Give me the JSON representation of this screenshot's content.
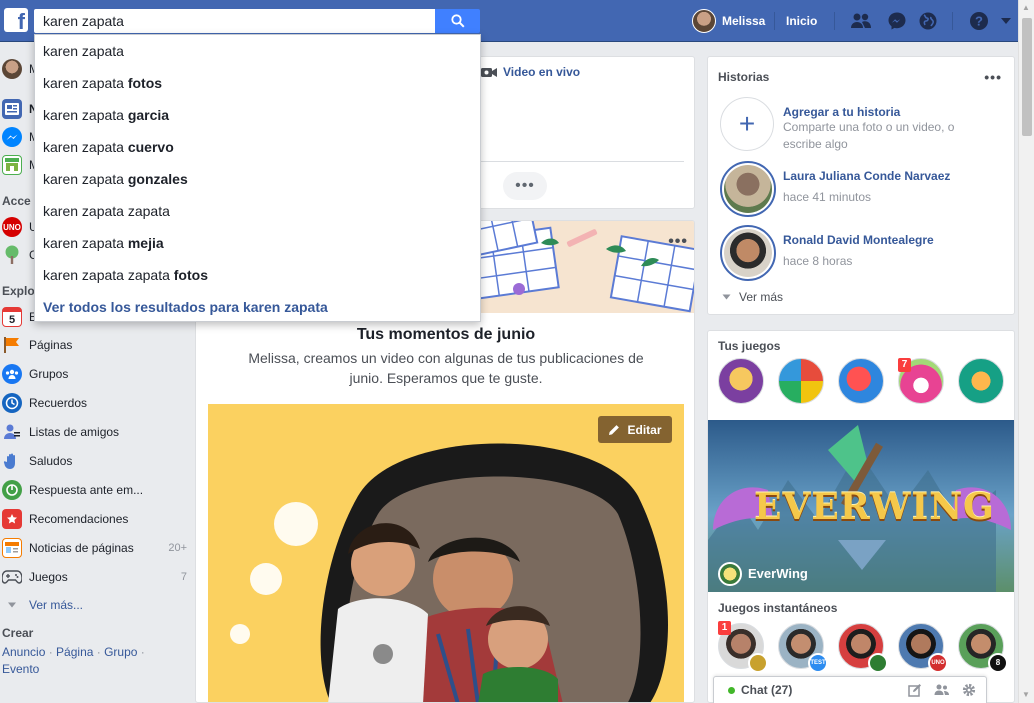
{
  "topbar": {
    "logo": "f",
    "search_value": "karen zapata",
    "user_name": "Melissa",
    "home_label": "Inicio",
    "icons": [
      "friend-requests-icon",
      "messenger-icon",
      "notifications-globe-icon",
      "help-icon",
      "account-menu-icon"
    ]
  },
  "search_suggestions": {
    "items": [
      {
        "base": "karen zapata",
        "bold": ""
      },
      {
        "base": "karen zapata ",
        "bold": "fotos"
      },
      {
        "base": "karen zapata ",
        "bold": "garcia"
      },
      {
        "base": "karen zapata ",
        "bold": "cuervo"
      },
      {
        "base": "karen zapata ",
        "bold": "gonzales"
      },
      {
        "base": "karen zapata zapata",
        "bold": ""
      },
      {
        "base": "karen zapata ",
        "bold": "mejia"
      },
      {
        "base": "karen zapata zapata ",
        "bold": "fotos"
      }
    ],
    "see_all": "Ver todos los resultados para karen zapata"
  },
  "left_nav": {
    "profile_initial": "M",
    "top_items": [
      {
        "label": "N",
        "icon": "news-feed-icon"
      },
      {
        "label": "M",
        "icon": "messenger-icon"
      },
      {
        "label": "M",
        "icon": "marketplace-icon"
      }
    ],
    "shortcuts_head": "Acce",
    "shortcuts": [
      {
        "label": "U",
        "icon": "uno-game-icon"
      },
      {
        "label": "G",
        "icon": "tree-icon"
      }
    ],
    "explore_head": "Explo",
    "explore_first": {
      "label": "E",
      "icon": "events-calendar-icon",
      "calendar_day": "5"
    },
    "explore": [
      {
        "label": "Páginas",
        "icon": "pages-flag-icon",
        "count": ""
      },
      {
        "label": "Grupos",
        "icon": "groups-icon",
        "count": ""
      },
      {
        "label": "Recuerdos",
        "icon": "memories-clock-icon",
        "count": ""
      },
      {
        "label": "Listas de amigos",
        "icon": "friend-lists-icon",
        "count": ""
      },
      {
        "label": "Saludos",
        "icon": "pokes-hand-icon",
        "count": ""
      },
      {
        "label": "Respuesta ante em...",
        "icon": "crisis-response-icon",
        "count": ""
      },
      {
        "label": "Recomendaciones",
        "icon": "recommendations-icon",
        "count": ""
      },
      {
        "label": "Noticias de páginas",
        "icon": "pages-feed-icon",
        "count": "20+"
      },
      {
        "label": "Juegos",
        "icon": "games-controller-icon",
        "count": "7"
      }
    ],
    "see_more": "Ver más...",
    "create_head": "Crear",
    "create_links": [
      "Anuncio",
      "Página",
      "Grupo",
      "Evento"
    ]
  },
  "composer": {
    "live_video": "Video en vivo",
    "more": "•••"
  },
  "memories": {
    "more": "•••",
    "title": "Tus momentos de junio",
    "description": "Melissa, creamos un video con algunas de tus publicaciones de junio. Esperamos que te guste.",
    "edit_label": "Editar"
  },
  "stories": {
    "title": "Historias",
    "more": "•••",
    "add_title": "Agregar a tu historia",
    "add_desc": "Comparte una foto o un video, o escribe algo",
    "items": [
      {
        "name": "Laura Juliana Conde Narvaez",
        "time": "hace 41 minutos"
      },
      {
        "name": "Ronald David Montealegre",
        "time": "hace 8 horas"
      }
    ],
    "see_more": "Ver más"
  },
  "games": {
    "title": "Tus juegos",
    "icons": [
      {
        "name": "game-hero-icon",
        "color": "#c0392b",
        "badge": ""
      },
      {
        "name": "game-trivia-wheel-icon",
        "color": "#27ae60",
        "badge": ""
      },
      {
        "name": "game-candy-crush-icon",
        "color": "#2e86de",
        "badge": ""
      },
      {
        "name": "game-candy-soda-icon",
        "color": "#e84393",
        "badge": "7"
      },
      {
        "name": "game-farm-heroes-icon",
        "color": "#16a085",
        "badge": ""
      }
    ],
    "featured_title": "EVERWING",
    "featured_name": "EverWing",
    "instant_title": "Juegos instantáneos",
    "friends": [
      {
        "name": "friend-avatar",
        "badge": "1",
        "mini": "#c8a12e"
      },
      {
        "name": "friend-avatar",
        "badge": "",
        "mini": "#2d8cf0"
      },
      {
        "name": "friend-avatar",
        "badge": "",
        "mini": "#2e7d32"
      },
      {
        "name": "friend-avatar",
        "badge": "",
        "mini": "#d32f2f"
      },
      {
        "name": "friend-avatar",
        "badge": "",
        "mini": "#111111"
      }
    ],
    "friend_minis": [
      "",
      "TEST",
      "",
      "UNO",
      "8"
    ]
  },
  "chat": {
    "label": "Chat (27)"
  },
  "colors": {
    "brand": "#4267b2",
    "link": "#365899",
    "search_button": "#4080ff",
    "online": "#42b72a"
  }
}
